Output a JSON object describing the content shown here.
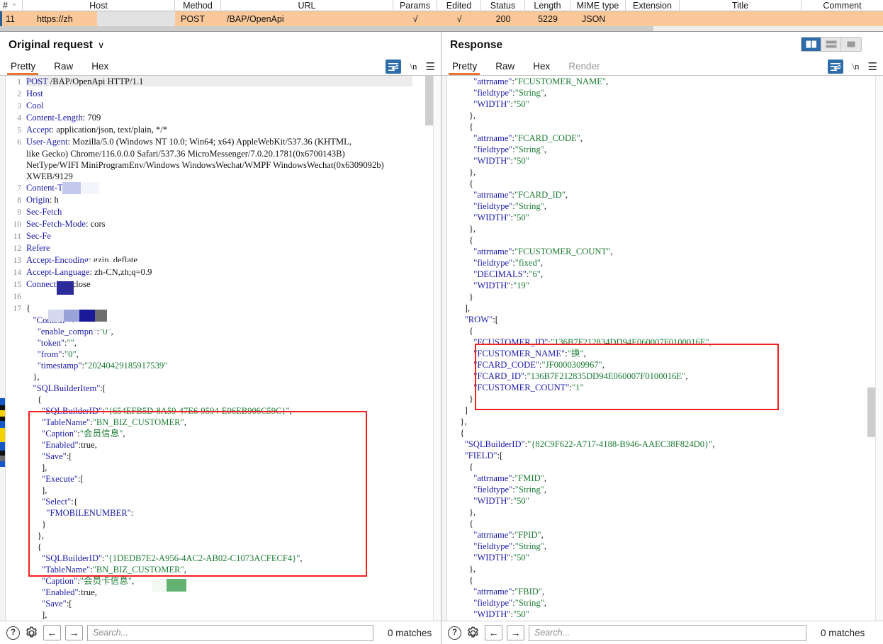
{
  "proxy_table": {
    "columns": [
      "#",
      "Host",
      "Method",
      "URL",
      "Params",
      "Edited",
      "Status",
      "Length",
      "MIME type",
      "Extension",
      "Title",
      "Comment"
    ],
    "sort_indicator": "^",
    "rows": [
      {
        "num": "11",
        "host": "https://zh",
        "method": "POST",
        "url": "/BAP/OpenApi",
        "params": "√",
        "edited": "√",
        "status": "200",
        "length": "5229",
        "mime": "JSON",
        "extension": "",
        "title": "",
        "comment": ""
      }
    ]
  },
  "request_pane": {
    "title": "Original request",
    "chevron": "∨",
    "tabs": [
      {
        "label": "Pretty",
        "active": true
      },
      {
        "label": "Raw",
        "active": false
      },
      {
        "label": "Hex",
        "active": false
      }
    ],
    "tools": {
      "wrap": "wrap-lines-icon",
      "newline": "\\n",
      "menu": "☰"
    },
    "lines": [
      {
        "n": "1",
        "text": "POST /BAP/OpenApi HTTP/1.1"
      },
      {
        "n": "2",
        "text": "Host"
      },
      {
        "n": "3",
        "text": "Cool"
      },
      {
        "n": "4",
        "text": "Content-Length: 709"
      },
      {
        "n": "5",
        "text": "Accept: application/json, text/plain, */*"
      },
      {
        "n": "6",
        "text": "User-Agent: Mozilla/5.0 (Windows NT 10.0; Win64; x64) AppleWebKit/537.36 (KHTML,"
      },
      {
        "n": "",
        "text": "like Gecko) Chrome/116.0.0.0 Safari/537.36 MicroMessenger/7.0.20.1781(0x6700143B)"
      },
      {
        "n": "",
        "text": "NetType/WIFI MiniProgramEnv/Windows WindowsWechat/WMPF WindowsWechat(0x6309092b)"
      },
      {
        "n": "",
        "text": "XWEB/9129"
      },
      {
        "n": "7",
        "text": "Content-T"
      },
      {
        "n": "8",
        "text": "Origin: h"
      },
      {
        "n": "9",
        "text": "Sec-Fetch"
      },
      {
        "n": "10",
        "text": "Sec-Fetch-Mode: cors"
      },
      {
        "n": "11",
        "text": "Sec-Fe"
      },
      {
        "n": "12",
        "text": "Refere"
      },
      {
        "n": "13",
        "text": "Accept-Encoding: gzip, deflate"
      },
      {
        "n": "14",
        "text": "Accept-Language: zh-CN,zh;q=0.9"
      },
      {
        "n": "15",
        "text": "Connection: close"
      },
      {
        "n": "16",
        "text": ""
      },
      {
        "n": "17",
        "text": "{"
      }
    ],
    "body_lines": [
      "    \"Context\":{",
      "      \"enable_compn\":\"0\",",
      "      \"token\":\"\",",
      "      \"from\":\"0\",",
      "      \"timestamp\":\"20240429185917539\"",
      "    },",
      "    \"SQLBuilderItem\":[",
      "      {",
      "        \"SQLBuilderID\":\"{654EFB5D-8A59-47E6-9594-E06EB906C59C}\",",
      "        \"TableName\":\"BN_BIZ_CUSTOMER\",",
      "        \"Caption\":\"会员信息\",",
      "        \"Enabled\":true,",
      "        \"Save\":[",
      "        ],",
      "        \"Execute\":[",
      "        ],",
      "        \"Select\":{",
      "          \"FMOBILENUMBER\":",
      "        }",
      "      },",
      "      {",
      "        \"SQLBuilderID\":\"{1DEDB7E2-A956-4AC2-AB02-C1073ACFECF4}\",",
      "        \"TableName\":\"BN_BIZ_CUSTOMER\",",
      "        \"Caption\":\"会员卡信息\",",
      "        \"Enabled\":true,",
      "        \"Save\":[",
      "        ],"
    ],
    "search": {
      "placeholder": "Search...",
      "matches": "0 matches",
      "help_icon": "?",
      "settings_icon": "gear-icon",
      "prev_icon": "←",
      "next_icon": "→"
    }
  },
  "response_pane": {
    "title": "Response",
    "tabs": [
      {
        "label": "Pretty",
        "active": true
      },
      {
        "label": "Raw",
        "active": false
      },
      {
        "label": "Hex",
        "active": false
      },
      {
        "label": "Render",
        "active": false,
        "dim": true
      }
    ],
    "layout_buttons": [
      {
        "name": "split-vertical",
        "active": true
      },
      {
        "name": "split-horizontal",
        "active": false
      },
      {
        "name": "single-pane",
        "active": false
      }
    ],
    "tools": {
      "wrap": "wrap-lines-icon",
      "newline": "\\n",
      "menu": "☰"
    },
    "lines": [
      "          \"attrname\":\"FCUSTOMER_NAME\",",
      "          \"fieldtype\":\"String\",",
      "          \"WIDTH\":\"50\"",
      "        },",
      "        {",
      "          \"attrname\":\"FCARD_CODE\",",
      "          \"fieldtype\":\"String\",",
      "          \"WIDTH\":\"50\"",
      "        },",
      "        {",
      "          \"attrname\":\"FCARD_ID\",",
      "          \"fieldtype\":\"String\",",
      "          \"WIDTH\":\"50\"",
      "        },",
      "        {",
      "          \"attrname\":\"FCUSTOMER_COUNT\",",
      "          \"fieldtype\":\"fixed\",",
      "          \"DECIMALS\":\"6\",",
      "          \"WIDTH\":\"19\"",
      "        }",
      "      ],",
      "      \"ROW\":[",
      "        {",
      "          \"FCUSTOMER_ID\":\"136B7F212834DD94E060007F0100016E\",",
      "          \"FCUSTOMER_NAME\":\"换\",",
      "          \"FCARD_CODE\":\"JF0000309967\",",
      "          \"FCARD_ID\":\"136B7F212835DD94E060007F0100016E\",",
      "          \"FCUSTOMER_COUNT\":\"1\"",
      "        }",
      "      ]",
      "    },",
      "    {",
      "      \"SQLBuilderID\":\"{82C9F622-A717-4188-B946-AAEC38F824D0}\",",
      "      \"FIELD\":[",
      "        {",
      "          \"attrname\":\"FMID\",",
      "          \"fieldtype\":\"String\",",
      "          \"WIDTH\":\"50\"",
      "        },",
      "        {",
      "          \"attrname\":\"FPID\",",
      "          \"fieldtype\":\"String\",",
      "          \"WIDTH\":\"50\"",
      "        },",
      "        {",
      "          \"attrname\":\"FBID\",",
      "          \"fieldtype\":\"String\",",
      "          \"WIDTH\":\"50\""
    ],
    "search": {
      "placeholder": "Search...",
      "matches": "0 matches",
      "help_icon": "?",
      "settings_icon": "gear-icon",
      "prev_icon": "←",
      "next_icon": "→"
    }
  },
  "annotations": {
    "request_highlight": "SQLBuilderItem block",
    "response_highlight": "ROW block",
    "highlight_color": "#f51f1f"
  },
  "colors": {
    "selected_row": "#fbc89a",
    "accent_tab": "#e8762c",
    "active_button": "#2d6ca8",
    "json_key": "#1a1aa8",
    "json_string": "#1a7a32"
  }
}
